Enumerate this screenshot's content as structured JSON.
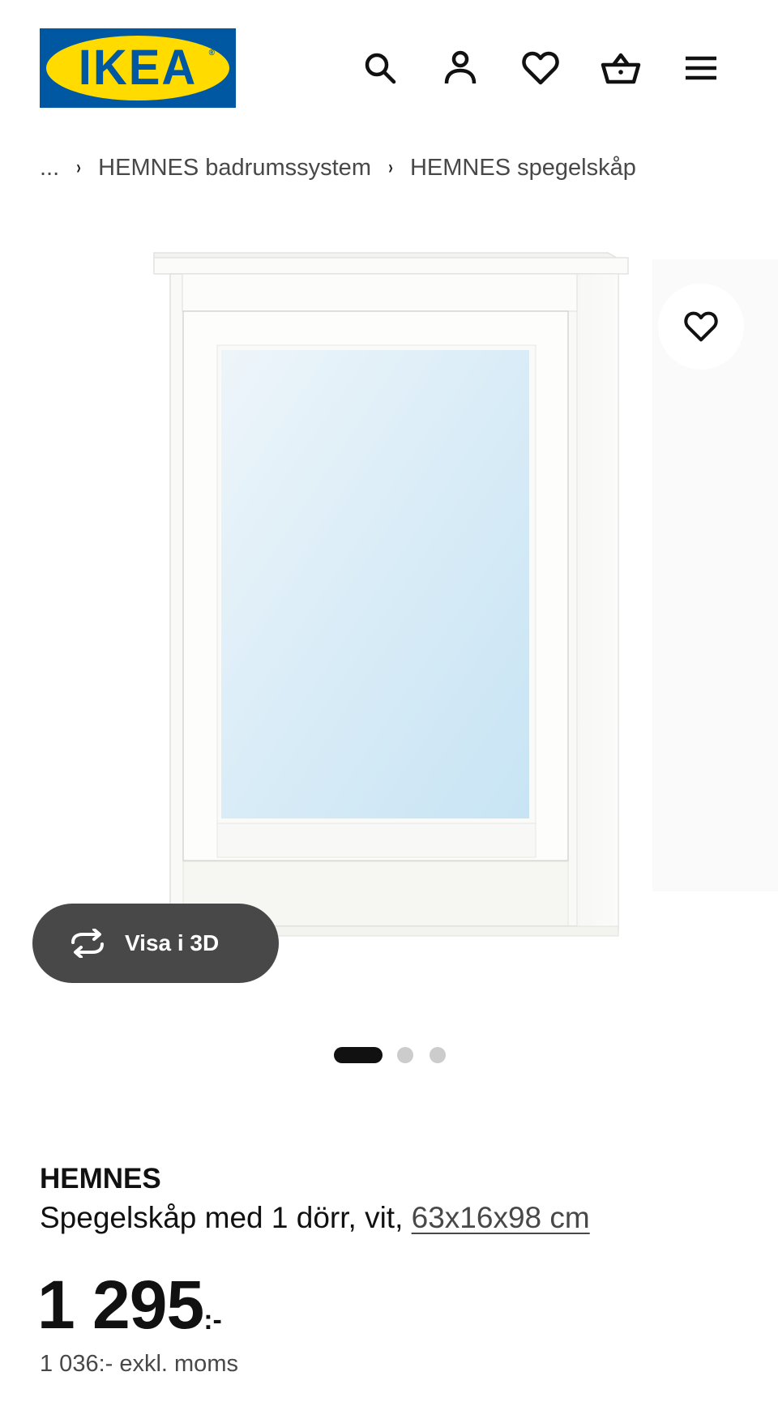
{
  "header": {
    "logo_text": "IKEA",
    "logo_colors": {
      "background": "#0058a3",
      "oval": "#ffdb00"
    },
    "icons": [
      "search-icon",
      "account-icon",
      "favourites-icon",
      "cart-icon",
      "menu-icon"
    ]
  },
  "breadcrumb": {
    "ellipsis": "...",
    "items": [
      "HEMNES badrumssystem",
      "HEMNES spegelskåp"
    ]
  },
  "gallery": {
    "image": "white-mirror-cabinet",
    "favourite_icon": "heart-icon",
    "view_3d_label": "Visa i 3D",
    "view_3d_icon": "rotate-3d-icon",
    "image_count": 3,
    "active_image": 1
  },
  "product": {
    "name": "HEMNES",
    "description": "Spegelskåp med 1 dörr, vit,",
    "dimensions": "63x16x98 cm",
    "price": "1 295",
    "price_suffix": ":-",
    "price_excl_vat": "1 036:- exkl. moms"
  }
}
